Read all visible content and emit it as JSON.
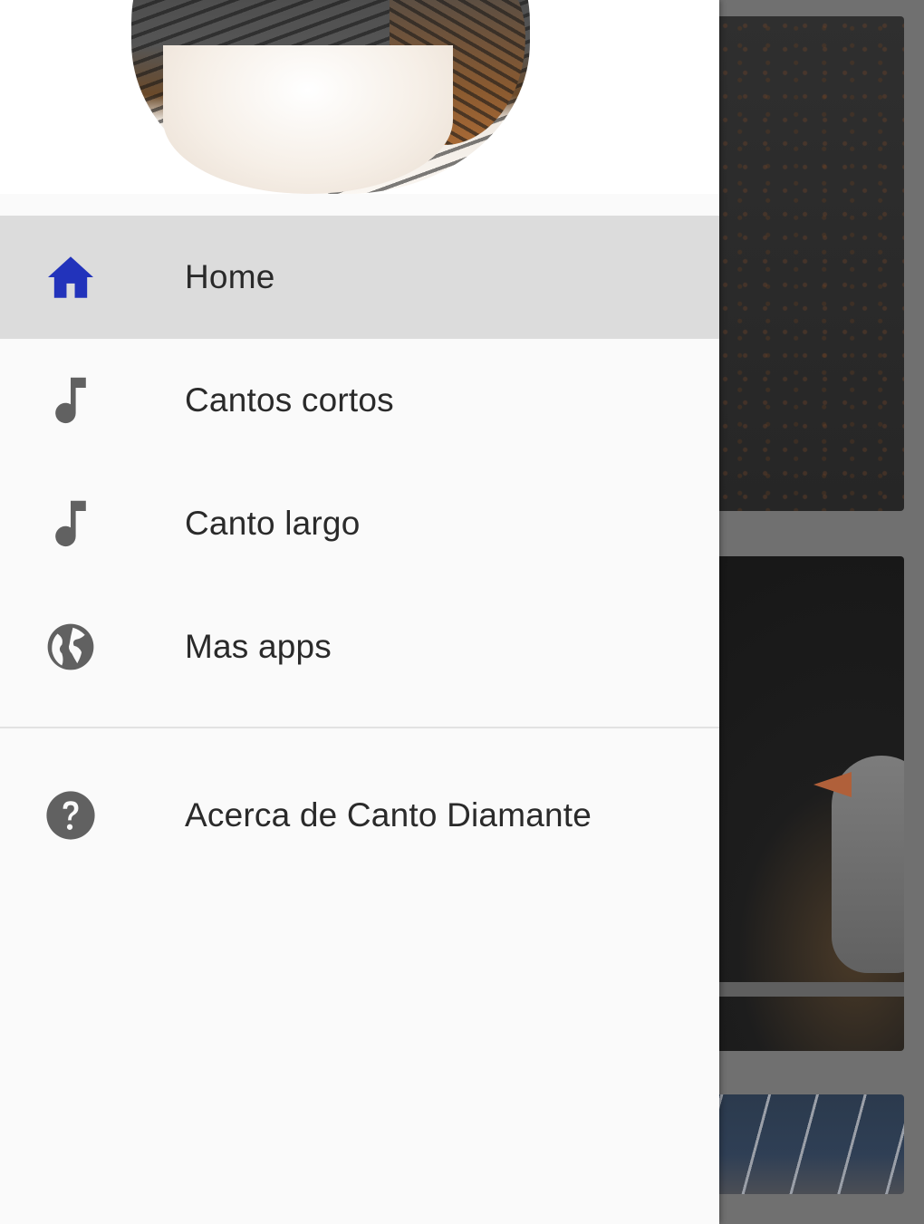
{
  "drawer": {
    "items": [
      {
        "label": "Home",
        "icon": "home-icon",
        "active": true,
        "icon_color": "#2233bb"
      },
      {
        "label": "Cantos cortos",
        "icon": "music-note-icon",
        "active": false
      },
      {
        "label": "Canto largo",
        "icon": "music-note-icon",
        "active": false
      },
      {
        "label": "Mas apps",
        "icon": "globe-icon",
        "active": false
      }
    ],
    "footer_item": {
      "label": "Acerca de Canto Diamante",
      "icon": "help-icon"
    }
  },
  "colors": {
    "accent": "#2233bb",
    "icon_gray": "#616161",
    "active_bg": "#dcdcdc",
    "drawer_bg": "#fafafa"
  }
}
